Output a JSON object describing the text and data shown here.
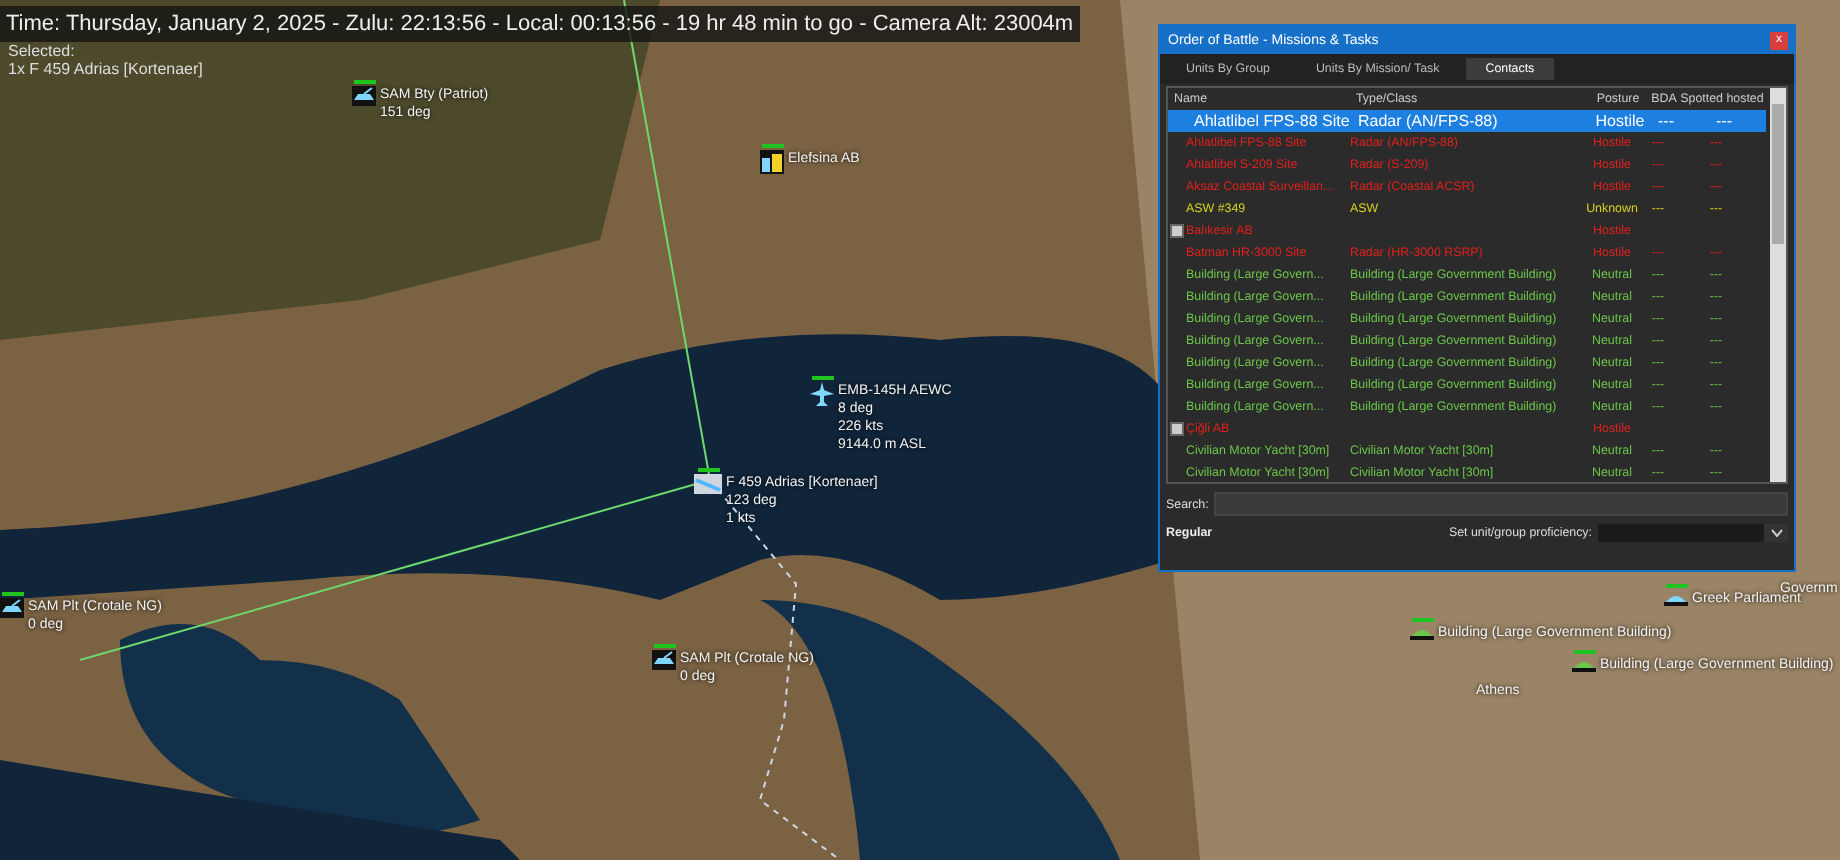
{
  "status_bar": {
    "time": "Time: Thursday, January 2, 2025 - Zulu: 22:13:56 - Local: 00:13:56 - 19 hr 48 min to go -  Camera Alt: 23004m",
    "selected_label": "Selected:",
    "selected_unit": "1x F 459 Adrias [Kortenaer]"
  },
  "map_labels": [
    {
      "kind": "sam",
      "lines": [
        "SAM Bty (Patriot)",
        "151 deg"
      ]
    },
    {
      "kind": "airbase",
      "lines": [
        "Elefsina AB"
      ]
    },
    {
      "kind": "aircraft",
      "lines": [
        "EMB-145H AEWC",
        "8 deg",
        "226 kts",
        "9144.0 m ASL"
      ]
    },
    {
      "kind": "ship",
      "lines": [
        "F 459 Adrias [Kortenaer]",
        "123 deg",
        "1 kts"
      ]
    },
    {
      "kind": "sam",
      "lines": [
        "SAM Plt (Crotale NG)",
        "0 deg"
      ]
    },
    {
      "kind": "sam",
      "lines": [
        "SAM Plt (Crotale NG)",
        "0 deg"
      ]
    },
    {
      "kind": "landmark",
      "lines": [
        "Greek Parliament"
      ]
    },
    {
      "kind": "building",
      "lines": [
        "Building (Large Government Building)"
      ]
    },
    {
      "kind": "building",
      "lines": [
        "Building (Large Government Building)"
      ]
    },
    {
      "kind": "place",
      "lines": [
        "Athens"
      ]
    },
    {
      "kind": "place",
      "lines": [
        "Governm"
      ]
    }
  ],
  "window": {
    "title": "Order of Battle - Missions & Tasks",
    "close": "x"
  },
  "tabs": [
    {
      "label": "Units By Group",
      "selected": false
    },
    {
      "label": "Units By Mission/ Task",
      "selected": false
    },
    {
      "label": "Contacts",
      "selected": true
    }
  ],
  "table": {
    "columns": [
      "Name",
      "Type/Class",
      "Posture",
      "BDA",
      "Spotted hosted"
    ],
    "rows": [
      {
        "expandable": false,
        "selected": true,
        "color": "#ffffff",
        "name": "Ahlatlibel FPS-88 Site",
        "type": "Radar (AN/FPS-88)",
        "posture": "Hostile",
        "bda": "---",
        "spotted": "---"
      },
      {
        "expandable": false,
        "selected": false,
        "color": "#e0201c",
        "name": "Ahlatlibel FPS-88 Site",
        "type": "Radar (AN/FPS-88)",
        "posture": "Hostile",
        "bda": "---",
        "spotted": "---"
      },
      {
        "expandable": false,
        "selected": false,
        "color": "#e0201c",
        "name": "Ahlatlibel S-209 Site",
        "type": "Radar (S-209)",
        "posture": "Hostile",
        "bda": "---",
        "spotted": "---"
      },
      {
        "expandable": false,
        "selected": false,
        "color": "#e0201c",
        "name": "Aksaz Coastal Surveillan...",
        "type": "Radar (Coastal ACSR)",
        "posture": "Hostile",
        "bda": "---",
        "spotted": "---"
      },
      {
        "expandable": false,
        "selected": false,
        "color": "#d6d21c",
        "name": "ASW #349",
        "type": "ASW",
        "posture": "Unknown",
        "bda": "---",
        "spotted": "---"
      },
      {
        "expandable": true,
        "selected": false,
        "color": "#e0201c",
        "name": "Balıkesir AB",
        "posture": "Hostile"
      },
      {
        "expandable": false,
        "selected": false,
        "color": "#e0201c",
        "name": "Batman HR-3000 Site",
        "type": "Radar (HR-3000 RSRP)",
        "posture": "Hostile",
        "bda": "---",
        "spotted": "---"
      },
      {
        "expandable": false,
        "selected": false,
        "color": "#6cc64a",
        "name": "Building (Large Govern...",
        "type": "Building (Large Government Building)",
        "posture": "Neutral",
        "bda": "---",
        "spotted": "---"
      },
      {
        "expandable": false,
        "selected": false,
        "color": "#6cc64a",
        "name": "Building (Large Govern...",
        "type": "Building (Large Government Building)",
        "posture": "Neutral",
        "bda": "---",
        "spotted": "---"
      },
      {
        "expandable": false,
        "selected": false,
        "color": "#6cc64a",
        "name": "Building (Large Govern...",
        "type": "Building (Large Government Building)",
        "posture": "Neutral",
        "bda": "---",
        "spotted": "---"
      },
      {
        "expandable": false,
        "selected": false,
        "color": "#6cc64a",
        "name": "Building (Large Govern...",
        "type": "Building (Large Government Building)",
        "posture": "Neutral",
        "bda": "---",
        "spotted": "---"
      },
      {
        "expandable": false,
        "selected": false,
        "color": "#6cc64a",
        "name": "Building (Large Govern...",
        "type": "Building (Large Government Building)",
        "posture": "Neutral",
        "bda": "---",
        "spotted": "---"
      },
      {
        "expandable": false,
        "selected": false,
        "color": "#6cc64a",
        "name": "Building (Large Govern...",
        "type": "Building (Large Government Building)",
        "posture": "Neutral",
        "bda": "---",
        "spotted": "---"
      },
      {
        "expandable": false,
        "selected": false,
        "color": "#6cc64a",
        "name": "Building (Large Govern...",
        "type": "Building (Large Government Building)",
        "posture": "Neutral",
        "bda": "---",
        "spotted": "---"
      },
      {
        "expandable": true,
        "selected": false,
        "color": "#e0201c",
        "name": "Çiğli AB",
        "posture": "Hostile"
      },
      {
        "expandable": false,
        "selected": false,
        "color": "#6cc64a",
        "name": "Civilian Motor Yacht [30m]",
        "type": "Civilian Motor Yacht [30m]",
        "posture": "Neutral",
        "bda": "---",
        "spotted": "---"
      },
      {
        "expandable": false,
        "selected": false,
        "color": "#6cc64a",
        "name": "Civilian Motor Yacht [30m]",
        "type": "Civilian Motor Yacht [30m]",
        "posture": "Neutral",
        "bda": "---",
        "spotted": "---"
      }
    ]
  },
  "footer": {
    "search_label": "Search:",
    "proficiency": "Regular",
    "proficiency_label": "Set unit/group proficiency:"
  }
}
